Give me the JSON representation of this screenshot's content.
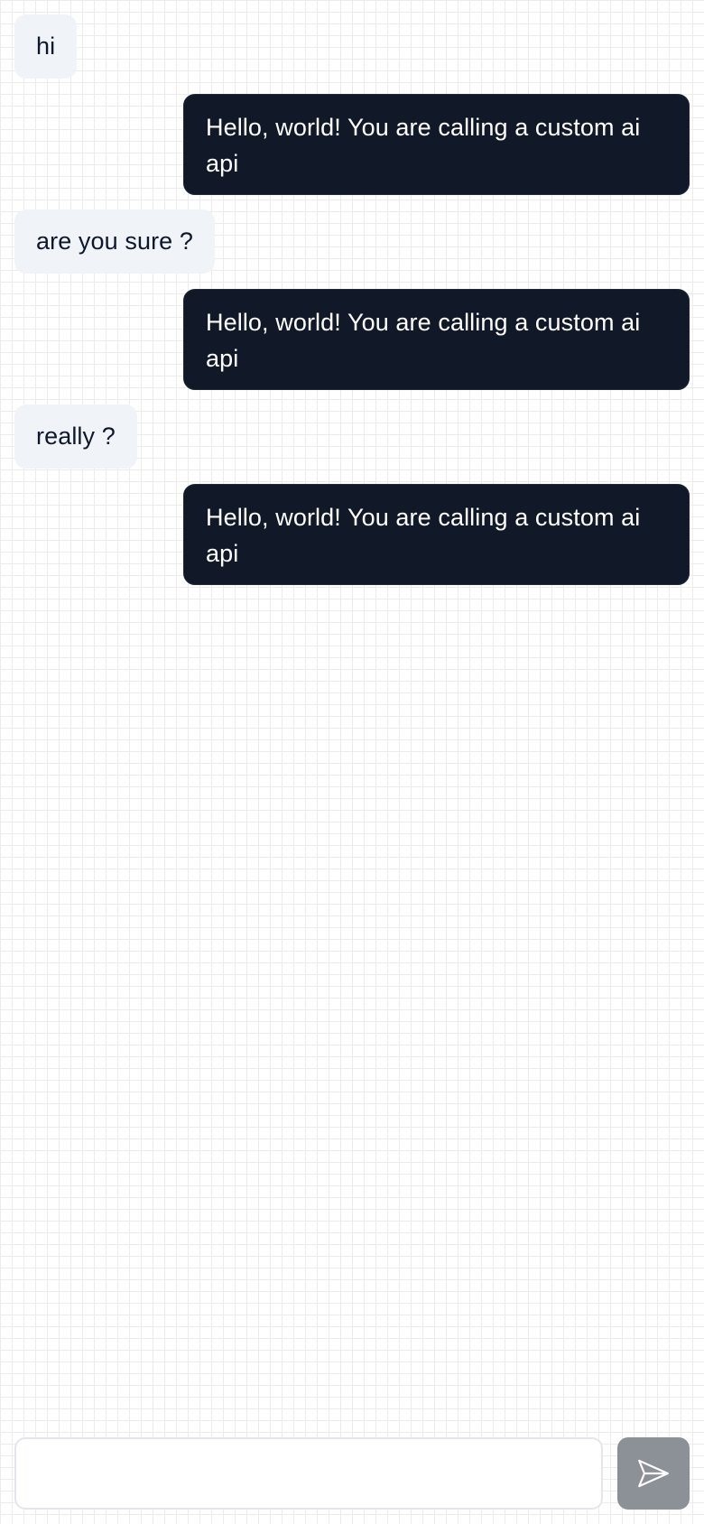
{
  "messages": [
    {
      "role": "user",
      "text": "hi"
    },
    {
      "role": "assistant",
      "text": "Hello, world! You are calling a custom ai api"
    },
    {
      "role": "user",
      "text": "are you sure ?"
    },
    {
      "role": "assistant",
      "text": "Hello, world! You are calling a custom ai api"
    },
    {
      "role": "user",
      "text": "really ?"
    },
    {
      "role": "assistant",
      "text": "Hello, world! You are calling a custom ai api"
    }
  ],
  "composer": {
    "value": "",
    "placeholder": "",
    "send_icon": "send-icon",
    "send_disabled": true
  },
  "colors": {
    "user_bubble": "#f0f3f8",
    "assistant_bubble": "#111827",
    "send_button_disabled": "#8c9097"
  }
}
